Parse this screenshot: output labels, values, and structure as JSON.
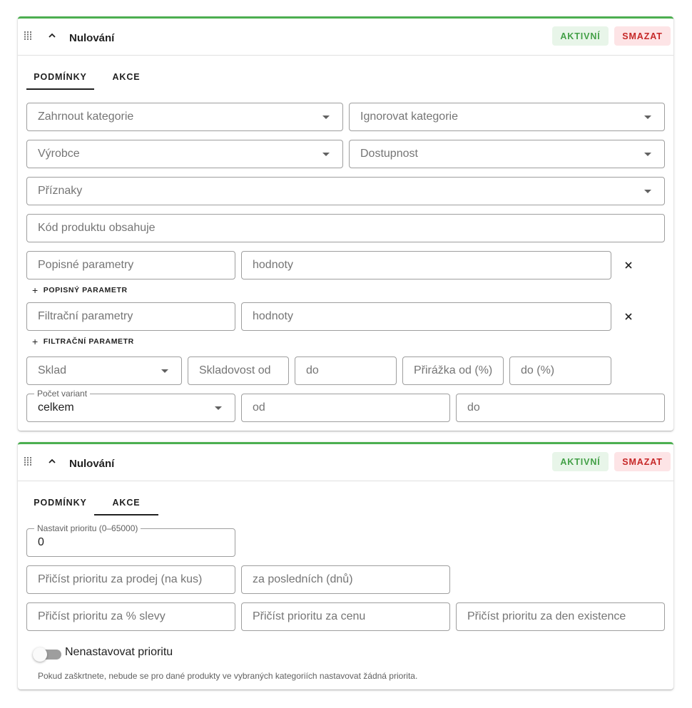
{
  "cards": [
    {
      "title": "Nulování",
      "active_label": "AKTIVNÍ",
      "delete_label": "SMAZAT",
      "tabs": [
        "PODMÍNKY",
        "AKCE"
      ],
      "active_tab": "PODMÍNKY",
      "fields": {
        "include_categories": "Zahrnout kategorie",
        "ignore_categories": "Ignorovat kategorie",
        "manufacturer": "Výrobce",
        "availability": "Dostupnost",
        "flags": "Příznaky",
        "product_code": "Kód produktu obsahuje",
        "desc_params": "Popisné parametry",
        "desc_values": "hodnoty",
        "add_desc_param": "POPISNÝ PARAMETR",
        "filter_params": "Filtrační parametry",
        "filter_values": "hodnoty",
        "add_filter_param": "FILTRAČNÍ PARAMETR",
        "warehouse": "Sklad",
        "stock_from": "Skladovost od",
        "stock_to": "do",
        "markup_from": "Přirážka od (%)",
        "markup_to": "do (%)",
        "variants_label": "Počet variant",
        "variants_value": "celkem",
        "variants_from": "od",
        "variants_to": "do"
      }
    },
    {
      "title": "Nulování",
      "active_label": "AKTIVNÍ",
      "delete_label": "SMAZAT",
      "tabs": [
        "PODMÍNKY",
        "AKCE"
      ],
      "active_tab": "AKCE",
      "fields": {
        "priority_label": "Nastavit prioritu (0–65000)",
        "priority_value": "0",
        "sale_priority": "Přičíst prioritu za prodej (na kus)",
        "last_days": "za posledních (dnů)",
        "discount_priority": "Přičíst prioritu za % slevy",
        "price_priority": "Přičíst prioritu za cenu",
        "existence_priority": "Přičíst prioritu za den existence",
        "toggle_label": "Nenastavovat prioritu",
        "toggle_on": false,
        "hint": "Pokud zaškrtnete, nebude se pro dané produkty ve vybraných kategoriích nastavovat žádná priorita."
      }
    }
  ],
  "colors": {
    "accent_green": "#4caf50",
    "active_bg": "#e8f5e9",
    "active_text": "#43a047",
    "delete_bg": "#fde4e6",
    "delete_text": "#c62828"
  },
  "icons": {
    "drag": "drag-handle-icon",
    "collapse": "chevron-up-icon",
    "dropdown": "caret-down-icon",
    "remove": "close-icon",
    "add": "plus-icon"
  }
}
